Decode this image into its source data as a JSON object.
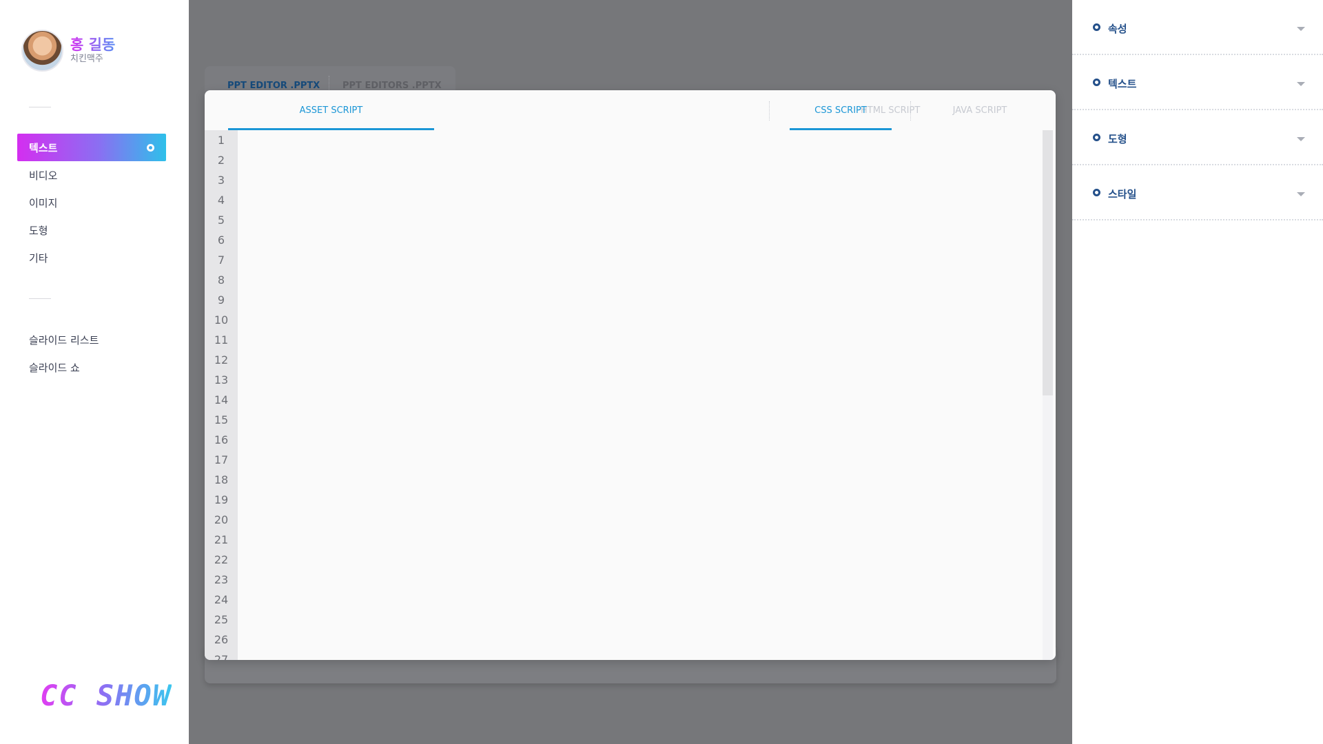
{
  "profile": {
    "name": "홍 길동",
    "subtitle": "치킨맥주"
  },
  "sidebar": {
    "items": [
      {
        "label": "텍스트",
        "active": true
      },
      {
        "label": "비디오",
        "active": false
      },
      {
        "label": "이미지",
        "active": false
      },
      {
        "label": "도형",
        "active": false
      },
      {
        "label": "기타",
        "active": false
      }
    ],
    "secondary": [
      {
        "label": "슬라이드 리스트"
      },
      {
        "label": "슬라이드 쇼"
      }
    ],
    "logo": "CC SHOW"
  },
  "files": {
    "active": "PPT EDITOR .PPTX",
    "inactive": "PPT EDITORS .PPTX"
  },
  "editor": {
    "tabs": [
      {
        "label": "ASSET SCRIPT",
        "active": true
      },
      {
        "label": "HTML SCRIPT",
        "active": false
      },
      {
        "label": "CSS SCRIPT",
        "active": true
      },
      {
        "label": "JAVA SCRIPT",
        "active": false
      }
    ],
    "line_numbers": [
      "1",
      "2",
      "3",
      "4",
      "5",
      "6",
      "7",
      "8",
      "9",
      "10",
      "11",
      "12",
      "13",
      "14",
      "15",
      "16",
      "17",
      "18",
      "19",
      "20",
      "21",
      "22",
      "23",
      "24",
      "25",
      "26",
      "27"
    ]
  },
  "properties": {
    "sections": [
      {
        "label": "속성"
      },
      {
        "label": "텍스트"
      },
      {
        "label": "도형"
      },
      {
        "label": "스타일"
      }
    ]
  },
  "colors": {
    "accent": "#1b96d6",
    "prop_text": "#24508a",
    "active_gradient_start": "#d42ef0",
    "active_gradient_end": "#2ec0ea"
  }
}
